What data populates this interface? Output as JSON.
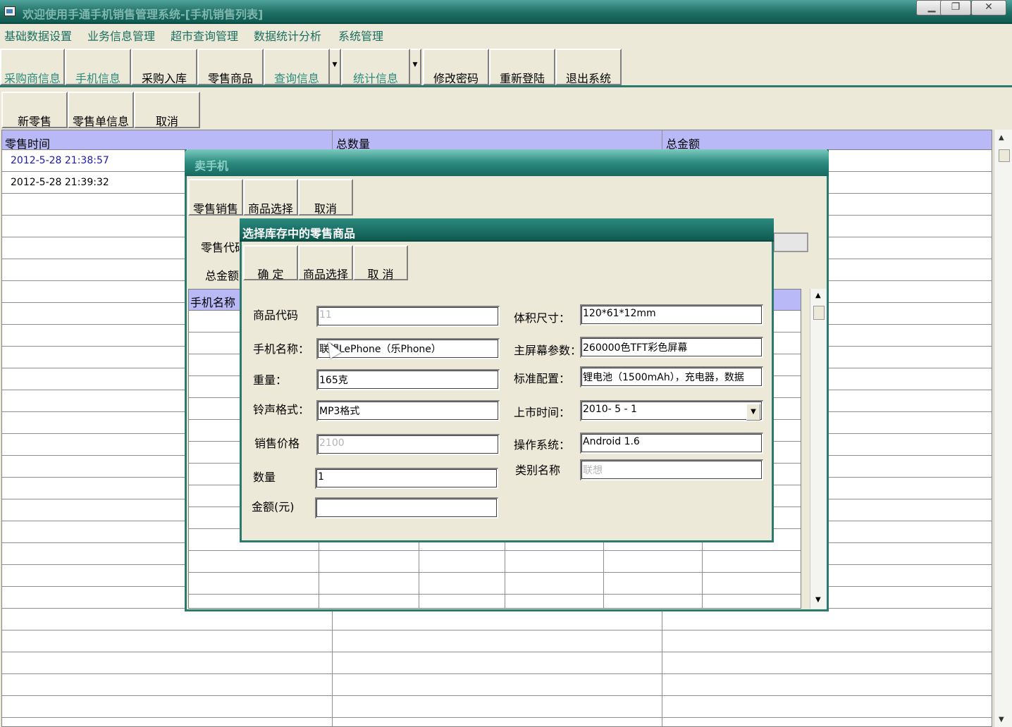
{
  "window": {
    "title": "欢迎使用手通手机销售管理系统-[手机销售列表]"
  },
  "menu": [
    "基础数据设置",
    "业务信息管理",
    "超市查询管理",
    "数据统计分析",
    "系统管理"
  ],
  "toolbar": {
    "buttons": [
      "采购商信息",
      "手机信息",
      "采购入库",
      "零售商品",
      "查询信息",
      "统计信息",
      "修改密码",
      "重新登陆",
      "退出系统"
    ]
  },
  "subtoolbar": {
    "buttons": [
      "新零售",
      "零售单信息",
      "取消"
    ]
  },
  "grid": {
    "columns": [
      "零售时间",
      "总数量",
      "总金额"
    ],
    "rows": [
      [
        "2012-5-28 21:38:57",
        "",
        ""
      ],
      [
        "2012-5-28 21:39:32",
        "",
        ""
      ]
    ]
  },
  "sell_window": {
    "title": "卖手机",
    "buttons": [
      "零售销售",
      "商品选择",
      "取消"
    ],
    "labels": {
      "code": "零售代码",
      "total": "总金额"
    },
    "grid_header": "手机名称"
  },
  "select_dialog": {
    "title": "选择库存中的零售商品",
    "buttons": [
      "确 定",
      "商品选择",
      "取 消"
    ],
    "fields": {
      "product_code": {
        "label": "商品代码",
        "value": "11"
      },
      "phone_name": {
        "label": "手机名称：",
        "value": "联想LePhone（乐Phone）"
      },
      "weight": {
        "label": "重量：",
        "value": "165克"
      },
      "ringtone": {
        "label": "铃声格式：",
        "value": "MP3格式"
      },
      "price": {
        "label": "销售价格",
        "value": "2100"
      },
      "quantity": {
        "label": "数量",
        "value": "1"
      },
      "amount": {
        "label": "金额(元)",
        "value": ""
      },
      "size": {
        "label": "体积尺寸：",
        "value": "120*61*12mm"
      },
      "screen": {
        "label": "主屏幕参数：",
        "value": "260000色TFT彩色屏幕"
      },
      "config": {
        "label": "标准配置：",
        "value": "锂电池（1500mAh），充电器，数据"
      },
      "launch": {
        "label": "上市时间：",
        "value": "2010- 5 - 1"
      },
      "os": {
        "label": "操作系统：",
        "value": "Android 1.6"
      },
      "category": {
        "label": "类别名称",
        "value": "联想"
      }
    }
  },
  "colors": {
    "accent": "#2c7a6f",
    "grid_header": "#b9b9f7",
    "dim_text": "#2c8a7e"
  }
}
